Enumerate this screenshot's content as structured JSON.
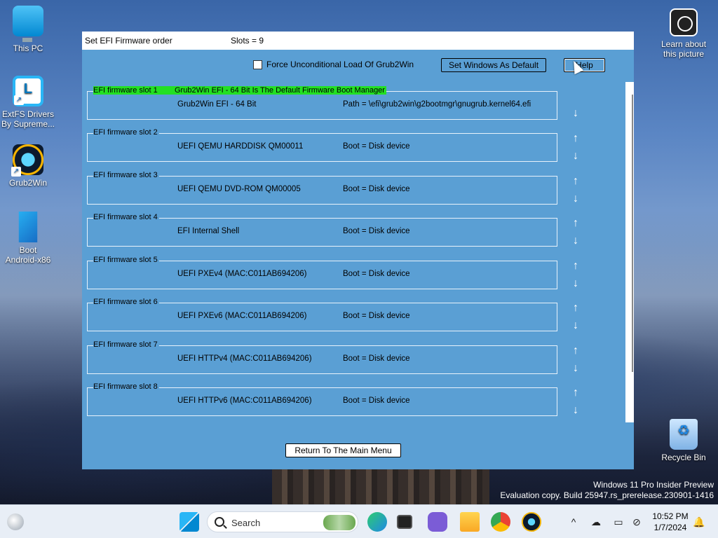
{
  "desktop": {
    "icons": [
      {
        "label": "This PC"
      },
      {
        "label": "ExtFS Drivers\nBy Supreme..."
      },
      {
        "label": "Grub2Win"
      },
      {
        "label": "Boot\nAndroid-x86"
      }
    ],
    "learn_about": "Learn about\nthis picture",
    "recycle_bin": "Recycle Bin",
    "watermark_line1": "Windows 11 Pro Insider Preview",
    "watermark_line2": "Evaluation copy. Build 25947.rs_prerelease.230901-1416"
  },
  "window": {
    "title": "Set EFI Firmware order",
    "slots_count": "Slots = 9",
    "force_label": "Force Unconditional Load Of Grub2Win",
    "force_checked": false,
    "set_default_button": "Set Windows As Default",
    "help_button": "Help",
    "return_button": "Return To The Main Menu",
    "default_banner": "Grub2Win EFI - 64 Bit Is The Default Firmware Boot Manager",
    "slots": [
      {
        "title": "EFI firmware slot 1",
        "desc": "Grub2Win EFI - 64 Bit",
        "info": "Path = \\efi\\grub2win\\g2bootmgr\\gnugrub.kernel64.efi"
      },
      {
        "title": "EFI firmware slot 2",
        "desc": "UEFI QEMU HARDDISK QM00011",
        "info": "Boot = Disk device"
      },
      {
        "title": "EFI firmware slot 3",
        "desc": "UEFI QEMU DVD-ROM QM00005",
        "info": "Boot = Disk device"
      },
      {
        "title": "EFI firmware slot 4",
        "desc": "EFI Internal Shell",
        "info": "Boot = Disk device"
      },
      {
        "title": "EFI firmware slot 5",
        "desc": "UEFI PXEv4 (MAC:C011AB694206)",
        "info": "Boot = Disk device"
      },
      {
        "title": "EFI firmware slot 6",
        "desc": "UEFI PXEv6 (MAC:C011AB694206)",
        "info": "Boot = Disk device"
      },
      {
        "title": "EFI firmware slot 7",
        "desc": "UEFI HTTPv4 (MAC:C011AB694206)",
        "info": "Boot = Disk device"
      },
      {
        "title": "EFI firmware slot 8",
        "desc": "UEFI HTTPv6 (MAC:C011AB694206)",
        "info": "Boot = Disk device"
      }
    ]
  },
  "taskbar": {
    "search_placeholder": "Search",
    "time": "10:52 PM",
    "date": "1/7/2024"
  },
  "colors": {
    "window_bg": "#5a9fd4",
    "active_slot_highlight": "#23e023"
  }
}
